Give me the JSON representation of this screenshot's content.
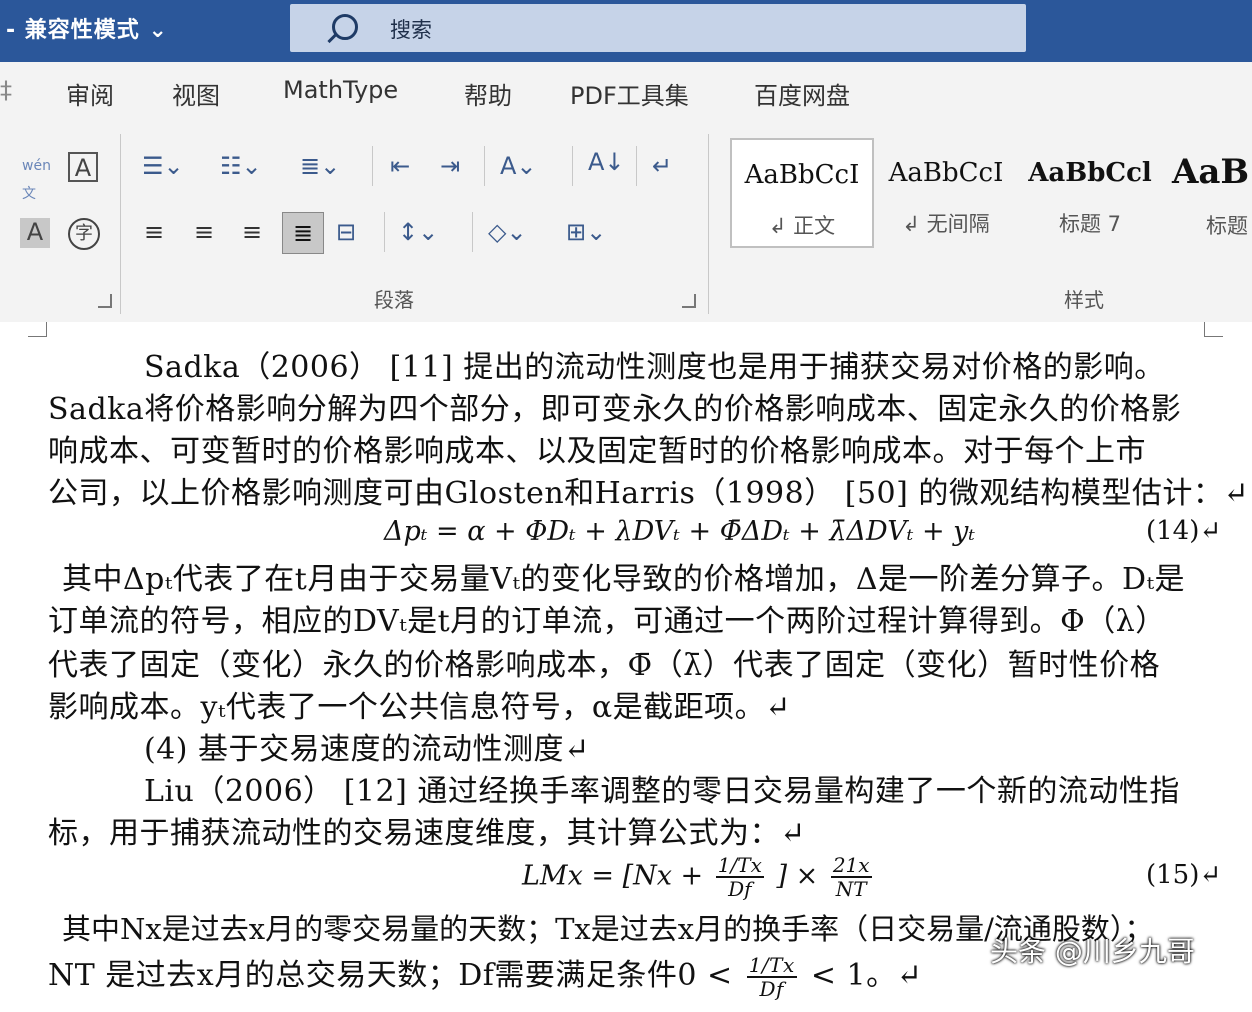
{
  "titlebar": {
    "mode_label": "- 兼容性模式 ⌄",
    "search_placeholder": "搜索"
  },
  "tabs": [
    "审阅",
    "视图",
    "MathType",
    "帮助",
    "PDF工具集",
    "百度网盘"
  ],
  "ribbon": {
    "paragraph_group_label": "段落",
    "styles_group_label": "样式",
    "styles": [
      {
        "sample": "AaBbCcI",
        "name": "↲ 正文"
      },
      {
        "sample": "AaBbCcI",
        "name": "↲ 无间隔"
      },
      {
        "sample": "AaBbCcl",
        "name": "标题 7"
      },
      {
        "sample": "AaB",
        "name": "标题"
      }
    ]
  },
  "document": {
    "p1": [
      "Sadka（2006）  [11] 提出的流动性测度也是用于捕获交易对价格的影响。",
      "Sadka将价格影响分解为四个部分，即可变永久的价格影响成本、固定永久的价格影",
      "响成本、可变暂时的价格影响成本、以及固定暂时的价格影响成本。对于每个上市",
      "公司，以上价格影响测度可由Glosten和Harris（1998）  [50] 的微观结构模型估计：↵"
    ],
    "eq14": "Δpₜ = α + ΦDₜ + λDVₜ + Φ̄ΔDₜ + λ̄ΔDVₜ + yₜ",
    "eq14_num": "(14)↵",
    "p2": [
      "其中Δpₜ代表了在t月由于交易量Vₜ的变化导致的价格增加，Δ是一阶差分算子。Dₜ是",
      "订单流的符号，相应的DVₜ是t月的订单流，可通过一个两阶过程计算得到。Φ（λ）",
      "代表了固定（变化）永久的价格影响成本，Φ̄（λ̄）代表了固定（变化）暂时性价格",
      "影响成本。yₜ代表了一个公共信息符号，α是截距项。↵"
    ],
    "heading4": "(4) 基于交易速度的流动性测度↵",
    "p3": [
      "Liu（2006）  [12] 通过经换手率调整的零日交易量构建了一个新的流动性指",
      "标，用于捕获流动性的交易速度维度，其计算公式为：↵"
    ],
    "eq15_left": "LMx = [Nx +",
    "eq15_frac1_num": "1/Tx",
    "eq15_frac1_den": "Df",
    "eq15_mid": "] ×",
    "eq15_frac2_num": "21x",
    "eq15_frac2_den": "NT",
    "eq15_num": "(15)↵",
    "p4_line1": "其中Nx是过去x月的零交易量的天数；Tx是过去x月的换手率（日交易量/流通股数）；",
    "p4_line2_a": "NT 是过去x月的总交易天数；Df需要满足条件0 <",
    "p4_line2_frac_num": "1/Tx",
    "p4_line2_frac_den": "Df",
    "p4_line2_b": "< 1。↵"
  },
  "watermark": "头条 @川乡九哥"
}
